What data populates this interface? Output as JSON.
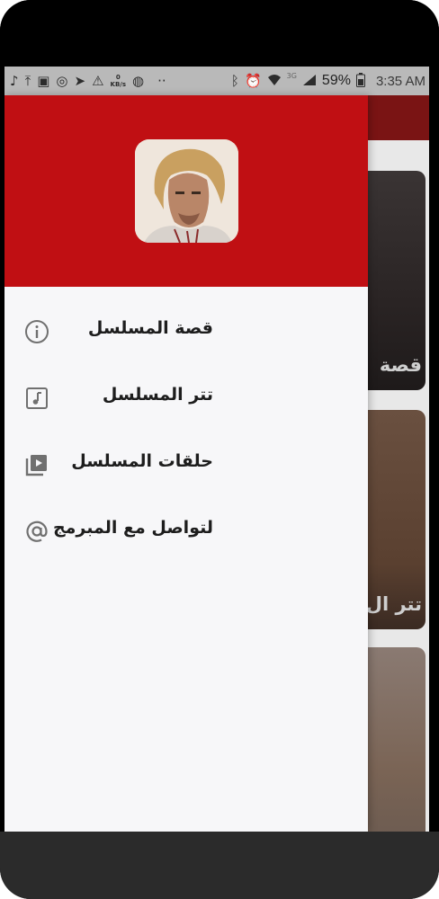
{
  "status_bar": {
    "icons": [
      "music-note-icon",
      "upload-icon",
      "gallery-icon",
      "whatsapp-icon",
      "telegram-icon",
      "warning-icon",
      "data-speed-icon",
      "globe-icon",
      "more-dots-icon",
      "bluetooth-icon",
      "alarm-icon",
      "wifi-icon",
      "signal-icon",
      "battery-icon"
    ],
    "data_speed_value": "0",
    "data_speed_unit": "KB/s",
    "network_type": "3G",
    "battery_percent": "59%",
    "time": "3:35 AM"
  },
  "drawer": {
    "header_color": "#c00f13",
    "avatar": "actor-portrait",
    "items": [
      {
        "label": "قصة المسلسل",
        "icon": "info-icon"
      },
      {
        "label": "تتر المسلسل",
        "icon": "music-file-icon"
      },
      {
        "label": "حلقات المسلسل",
        "icon": "video-library-icon"
      },
      {
        "label": "لتواصل مع المبرمج",
        "icon": "at-sign-icon"
      }
    ]
  },
  "background_app": {
    "appbar_color": "#7a1414",
    "cards": [
      {
        "label": "قصة"
      },
      {
        "label": "تتر ال"
      },
      {
        "label": ""
      }
    ]
  }
}
